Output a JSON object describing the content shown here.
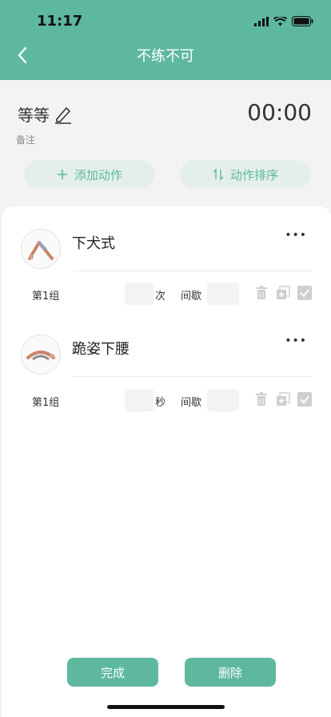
{
  "status": {
    "time": "11:17"
  },
  "nav": {
    "title": "不练不可"
  },
  "workout": {
    "name": "等等",
    "timer": "00:00",
    "note_label": "备注"
  },
  "actions": {
    "add": "添加动作",
    "sort": "动作排序"
  },
  "exercises": [
    {
      "name": "下犬式",
      "set": {
        "label": "第1组",
        "unit": "次",
        "rest_label": "间歇"
      }
    },
    {
      "name": "跪姿下腰",
      "set": {
        "label": "第1组",
        "unit": "秒",
        "rest_label": "间歇"
      }
    }
  ],
  "footer": {
    "done": "完成",
    "delete": "删除"
  },
  "colors": {
    "accent": "#5db89e",
    "pill_bg": "#e4efec"
  }
}
